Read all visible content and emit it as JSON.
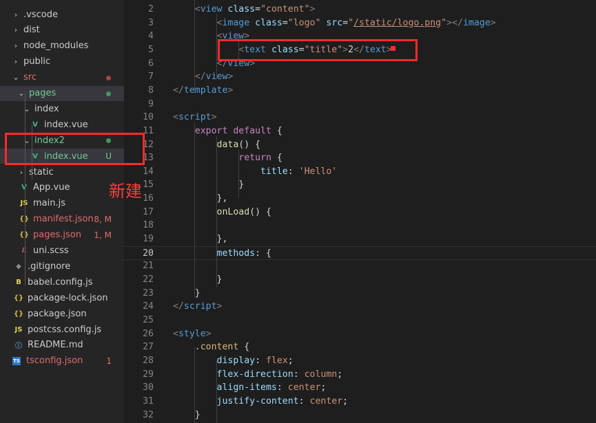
{
  "explorer": {
    "header": "...",
    "items": [
      {
        "label": ".vscode",
        "type": "folder",
        "icon": "chevron-right",
        "color": "#cccccc",
        "badge": ""
      },
      {
        "label": "dist",
        "type": "folder",
        "icon": "chevron-right",
        "color": "#cccccc",
        "badge": ""
      },
      {
        "label": "node_modules",
        "type": "folder",
        "icon": "chevron-right",
        "color": "#cccccc",
        "badge": ""
      },
      {
        "label": "public",
        "type": "folder",
        "icon": "chevron-right",
        "color": "#cccccc",
        "badge": ""
      },
      {
        "label": "src",
        "type": "folder-open",
        "icon": "chevron-down",
        "color": "#e06c6c",
        "badge": "dot-red"
      },
      {
        "label": "pages",
        "type": "folder-open",
        "icon": "chevron-down",
        "color": "#73c991",
        "badge": "dot-green"
      },
      {
        "label": "index",
        "type": "folder-open",
        "icon": "chevron-down",
        "color": "#cccccc",
        "badge": ""
      },
      {
        "label": "index.vue",
        "type": "vue-file",
        "icon": "vue-icon",
        "color": "#cccccc",
        "badge": ""
      },
      {
        "label": "index2",
        "type": "folder-open",
        "icon": "chevron-down",
        "color": "#73c991",
        "badge": "dot-green"
      },
      {
        "label": "index.vue",
        "type": "vue-file",
        "icon": "vue-icon",
        "color": "#73c991",
        "badge": "U"
      },
      {
        "label": "static",
        "type": "folder",
        "icon": "chevron-right",
        "color": "#cccccc",
        "badge": ""
      },
      {
        "label": "App.vue",
        "type": "vue-file",
        "icon": "vue-icon",
        "color": "#cccccc",
        "badge": ""
      },
      {
        "label": "main.js",
        "type": "js-file",
        "icon": "js-icon",
        "color": "#cccccc",
        "badge": ""
      },
      {
        "label": "manifest.json",
        "type": "json-file",
        "icon": "json-icon",
        "color": "#e06c6c",
        "badge": "8, M"
      },
      {
        "label": "pages.json",
        "type": "json-file",
        "icon": "json-icon",
        "color": "#e06c6c",
        "badge": "1, M"
      },
      {
        "label": "uni.scss",
        "type": "scss-file",
        "icon": "scss-icon",
        "color": "#cccccc",
        "badge": ""
      },
      {
        "label": ".gitignore",
        "type": "git-file",
        "icon": "git-icon",
        "color": "#cccccc",
        "badge": ""
      },
      {
        "label": "babel.config.js",
        "type": "babel-file",
        "icon": "babel-icon",
        "color": "#cccccc",
        "badge": ""
      },
      {
        "label": "package-lock.json",
        "type": "json-file",
        "icon": "json-icon",
        "color": "#cccccc",
        "badge": ""
      },
      {
        "label": "package.json",
        "type": "json-file",
        "icon": "json-icon",
        "color": "#cccccc",
        "badge": ""
      },
      {
        "label": "postcss.config.js",
        "type": "js-file",
        "icon": "js-icon",
        "color": "#cccccc",
        "badge": ""
      },
      {
        "label": "README.md",
        "type": "info-file",
        "icon": "info-icon",
        "color": "#cccccc",
        "badge": ""
      },
      {
        "label": "tsconfig.json",
        "type": "ts-file",
        "icon": "ts-icon",
        "color": "#e06c6c",
        "badge": "1"
      }
    ]
  },
  "annotation": {
    "text": "新建",
    "color": "#ff3b3b"
  },
  "editor": {
    "active_line": "20",
    "lines": [
      {
        "n": "2",
        "tokens": [
          [
            "    ",
            "txt"
          ],
          [
            "<",
            "punc"
          ],
          [
            "view",
            "tag"
          ],
          [
            " class",
            "attr"
          ],
          [
            "=",
            "txt"
          ],
          [
            "\"content\"",
            "str"
          ],
          [
            ">",
            "punc"
          ]
        ]
      },
      {
        "n": "3",
        "tokens": [
          [
            "        ",
            "txt"
          ],
          [
            "<",
            "punc"
          ],
          [
            "image",
            "tag"
          ],
          [
            " class",
            "attr"
          ],
          [
            "=",
            "txt"
          ],
          [
            "\"logo\"",
            "str"
          ],
          [
            " src",
            "attr"
          ],
          [
            "=",
            "txt"
          ],
          [
            "\"",
            "str"
          ],
          [
            "/static/logo.png",
            "str link"
          ],
          [
            "\"",
            "str"
          ],
          [
            ">",
            "punc"
          ],
          [
            "</",
            "punc"
          ],
          [
            "image",
            "tag"
          ],
          [
            ">",
            "punc"
          ]
        ]
      },
      {
        "n": "4",
        "tokens": [
          [
            "        ",
            "txt"
          ],
          [
            "<",
            "punc"
          ],
          [
            "view",
            "tag"
          ],
          [
            ">",
            "punc"
          ]
        ]
      },
      {
        "n": "5",
        "tokens": [
          [
            "            ",
            "txt"
          ],
          [
            "<",
            "punc"
          ],
          [
            "text",
            "tag"
          ],
          [
            " class",
            "attr"
          ],
          [
            "=",
            "txt"
          ],
          [
            "\"title\"",
            "str"
          ],
          [
            ">",
            "punc"
          ],
          [
            "2",
            "txt"
          ],
          [
            "</",
            "punc"
          ],
          [
            "text",
            "tag"
          ],
          [
            ">",
            "punc"
          ]
        ]
      },
      {
        "n": "6",
        "tokens": [
          [
            "        ",
            "txt"
          ],
          [
            "</",
            "punc"
          ],
          [
            "view",
            "tag"
          ],
          [
            ">",
            "punc"
          ]
        ]
      },
      {
        "n": "7",
        "tokens": [
          [
            "    ",
            "txt"
          ],
          [
            "</",
            "punc"
          ],
          [
            "view",
            "tag"
          ],
          [
            ">",
            "punc"
          ]
        ]
      },
      {
        "n": "8",
        "tokens": [
          [
            "</",
            "punc"
          ],
          [
            "template",
            "tag"
          ],
          [
            ">",
            "punc"
          ]
        ]
      },
      {
        "n": "9",
        "tokens": []
      },
      {
        "n": "10",
        "tokens": [
          [
            "<",
            "punc"
          ],
          [
            "script",
            "tag"
          ],
          [
            ">",
            "punc"
          ]
        ]
      },
      {
        "n": "11",
        "tokens": [
          [
            "    ",
            "txt"
          ],
          [
            "export",
            "kw"
          ],
          [
            " ",
            "txt"
          ],
          [
            "default",
            "kw"
          ],
          [
            " {",
            "txt"
          ]
        ]
      },
      {
        "n": "12",
        "tokens": [
          [
            "        ",
            "txt"
          ],
          [
            "data",
            "fn"
          ],
          [
            "() {",
            "txt"
          ]
        ]
      },
      {
        "n": "13",
        "tokens": [
          [
            "            ",
            "txt"
          ],
          [
            "return",
            "kw"
          ],
          [
            " {",
            "txt"
          ]
        ]
      },
      {
        "n": "14",
        "tokens": [
          [
            "                ",
            "txt"
          ],
          [
            "title",
            "prop"
          ],
          [
            ": ",
            "txt"
          ],
          [
            "'Hello'",
            "str"
          ]
        ]
      },
      {
        "n": "15",
        "tokens": [
          [
            "            ",
            "txt"
          ],
          [
            "}",
            "txt"
          ]
        ]
      },
      {
        "n": "16",
        "tokens": [
          [
            "        ",
            "txt"
          ],
          [
            "},",
            "txt"
          ]
        ]
      },
      {
        "n": "17",
        "tokens": [
          [
            "        ",
            "txt"
          ],
          [
            "onLoad",
            "fn"
          ],
          [
            "() {",
            "txt"
          ]
        ]
      },
      {
        "n": "18",
        "tokens": []
      },
      {
        "n": "19",
        "tokens": [
          [
            "        ",
            "txt"
          ],
          [
            "},",
            "txt"
          ]
        ]
      },
      {
        "n": "20",
        "tokens": [
          [
            "        ",
            "txt"
          ],
          [
            "methods",
            "prop"
          ],
          [
            ": ",
            "txt"
          ],
          [
            "{",
            "txt"
          ]
        ]
      },
      {
        "n": "21",
        "tokens": []
      },
      {
        "n": "22",
        "tokens": [
          [
            "        ",
            "txt"
          ],
          [
            "}",
            "txt"
          ]
        ]
      },
      {
        "n": "23",
        "tokens": [
          [
            "    ",
            "txt"
          ],
          [
            "}",
            "txt"
          ]
        ]
      },
      {
        "n": "24",
        "tokens": [
          [
            "</",
            "punc"
          ],
          [
            "script",
            "tag"
          ],
          [
            ">",
            "punc"
          ]
        ]
      },
      {
        "n": "25",
        "tokens": []
      },
      {
        "n": "26",
        "tokens": [
          [
            "<",
            "punc"
          ],
          [
            "style",
            "tag"
          ],
          [
            ">",
            "punc"
          ]
        ]
      },
      {
        "n": "27",
        "tokens": [
          [
            "    ",
            "txt"
          ],
          [
            ".content",
            "sel"
          ],
          [
            " {",
            "txt"
          ]
        ]
      },
      {
        "n": "28",
        "tokens": [
          [
            "        ",
            "txt"
          ],
          [
            "display",
            "prop"
          ],
          [
            ": ",
            "txt"
          ],
          [
            "flex",
            "str"
          ],
          [
            ";",
            "txt"
          ]
        ]
      },
      {
        "n": "29",
        "tokens": [
          [
            "        ",
            "txt"
          ],
          [
            "flex-direction",
            "prop"
          ],
          [
            ": ",
            "txt"
          ],
          [
            "column",
            "str"
          ],
          [
            ";",
            "txt"
          ]
        ]
      },
      {
        "n": "30",
        "tokens": [
          [
            "        ",
            "txt"
          ],
          [
            "align-items",
            "prop"
          ],
          [
            ": ",
            "txt"
          ],
          [
            "center",
            "str"
          ],
          [
            ";",
            "txt"
          ]
        ]
      },
      {
        "n": "31",
        "tokens": [
          [
            "        ",
            "txt"
          ],
          [
            "justify-content",
            "prop"
          ],
          [
            ": ",
            "txt"
          ],
          [
            "center",
            "str"
          ],
          [
            ";",
            "txt"
          ]
        ]
      },
      {
        "n": "32",
        "tokens": [
          [
            "    ",
            "txt"
          ],
          [
            "}",
            "txt"
          ]
        ]
      }
    ]
  }
}
